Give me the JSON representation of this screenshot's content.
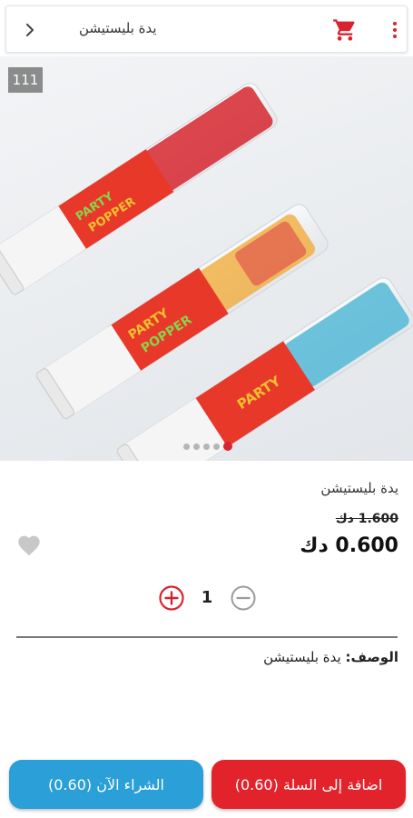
{
  "header": {
    "title": "يدة بليستيشن",
    "back_icon": "chevron-right-icon",
    "cart_icon": "shopping-cart-icon",
    "menu_icon": "more-vert-icon",
    "accent": "#d9232e"
  },
  "gallery": {
    "badge": "111",
    "slide_count": 5,
    "active_slide": 1,
    "image_label": "party popper confetti tubes",
    "printed_text": [
      "PARTY",
      "POPPER"
    ]
  },
  "product": {
    "name": "يدة بليستيشن",
    "old_price": "1.600 دك",
    "price": "0.600 دك",
    "favorite_icon": "heart-icon",
    "quantity": "1",
    "plus_icon": "plus-circle-icon",
    "minus_icon": "minus-circle-icon",
    "description_label": "الوصف:",
    "description_value": "يدة بليستيشن"
  },
  "actions": {
    "add_to_cart": "اضافة إلى السلة (0.60)",
    "buy_now": "الشراء الآن (0.60)",
    "add_to_cart_color": "#e3232c",
    "buy_now_color": "#2a9fd8"
  }
}
